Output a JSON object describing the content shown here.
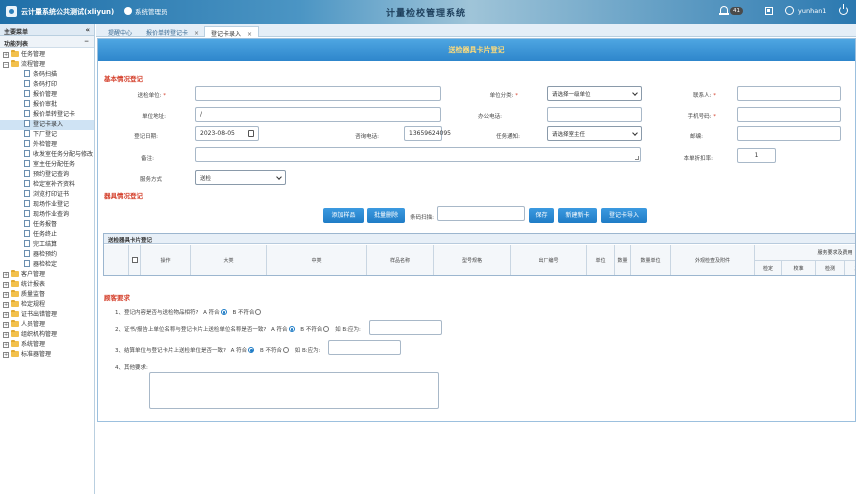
{
  "header": {
    "app_title": "云计量系统公共测试(xliyun)",
    "user_chip": "系统管理员",
    "system_title": "计量检校管理系统",
    "notification_count": "41",
    "username": "yunhan1"
  },
  "sidebar": {
    "main_menu": "主要菜单",
    "collapse": "«",
    "function_list": "功能列表",
    "function_toggle": "−",
    "items": [
      {
        "label": "任务管理",
        "type": "folder",
        "exp": "+"
      },
      {
        "label": "流程管理",
        "type": "folder",
        "exp": "−"
      },
      {
        "label": "条码扫描",
        "type": "leaf"
      },
      {
        "label": "条码打印",
        "type": "leaf"
      },
      {
        "label": "报价管理",
        "type": "leaf"
      },
      {
        "label": "报价审批",
        "type": "leaf"
      },
      {
        "label": "报价单转登记卡",
        "type": "leaf"
      },
      {
        "label": "登记卡录入",
        "type": "leaf",
        "active": true
      },
      {
        "label": "下厂登记",
        "type": "leaf"
      },
      {
        "label": "外检管理",
        "type": "leaf"
      },
      {
        "label": "收发室任务分配与修改",
        "type": "leaf"
      },
      {
        "label": "室主任分配任务",
        "type": "leaf"
      },
      {
        "label": "预约登记查询",
        "type": "leaf"
      },
      {
        "label": "检定室补齐资料",
        "type": "leaf"
      },
      {
        "label": "浏览打印证书",
        "type": "leaf"
      },
      {
        "label": "现场作业登记",
        "type": "leaf"
      },
      {
        "label": "现场作业查询",
        "type": "leaf"
      },
      {
        "label": "任务报督",
        "type": "leaf"
      },
      {
        "label": "任务终止",
        "type": "leaf"
      },
      {
        "label": "完工结算",
        "type": "leaf"
      },
      {
        "label": "器检预约",
        "type": "leaf"
      },
      {
        "label": "器检检定",
        "type": "leaf"
      },
      {
        "label": "客户管理",
        "type": "folder",
        "exp": "+"
      },
      {
        "label": "统计报表",
        "type": "folder",
        "exp": "+"
      },
      {
        "label": "质量监督",
        "type": "folder",
        "exp": "+"
      },
      {
        "label": "检定规程",
        "type": "folder",
        "exp": "+"
      },
      {
        "label": "证书出错管理",
        "type": "folder",
        "exp": "+"
      },
      {
        "label": "人员管理",
        "type": "folder",
        "exp": "+"
      },
      {
        "label": "组织机构管理",
        "type": "folder",
        "exp": "+"
      },
      {
        "label": "系统管理",
        "type": "folder",
        "exp": "+"
      },
      {
        "label": "标准器管理",
        "type": "folder",
        "exp": "+"
      }
    ]
  },
  "tabs": [
    {
      "label": "提醒中心",
      "active": false,
      "closable": false
    },
    {
      "label": "报价单转登记卡",
      "active": false,
      "closable": true
    },
    {
      "label": "登记卡录入",
      "active": true,
      "closable": true
    }
  ],
  "tab_close_glyph": "×",
  "form": {
    "banner": "送检器具卡片登记",
    "basic_section": "基本情况登记",
    "labels": {
      "submit_unit": "送检单位:",
      "unit_category": "单位分类:",
      "contact": "联系人:",
      "unit_address": "单位地址:",
      "office_phone": "办公电话:",
      "mobile": "手机号码:",
      "register_date": "登记日期:",
      "consult_phone": "咨询电话:",
      "task_notify": "任务通知:",
      "postcode": "邮编:",
      "remark": "备注:",
      "discount": "本单折扣率:",
      "service_mode": "服务方式"
    },
    "required_mark": "*",
    "values": {
      "submit_unit": "",
      "unit_address": "/",
      "office_phone": "",
      "mobile": "",
      "register_date": "2023-08-05",
      "consult_phone": "13659624095",
      "postcode": "",
      "remark": "",
      "discount": "1",
      "contact": ""
    },
    "selects": {
      "unit_category": "请选择一级单位",
      "task_notify": "请选择室主任",
      "service_mode": "送检"
    },
    "equipment_section": "器具情况登记",
    "buttons": {
      "add_sample": "添加样品",
      "batch_delete": "批量删除",
      "save": "保存",
      "new_card": "新建新卡",
      "import_card": "登记卡导入"
    },
    "barcode_label": "条码扫描:",
    "barcode_value": ""
  },
  "table": {
    "title": "送检器具卡片登记",
    "columns": [
      "",
      "操作",
      "大类",
      "中类",
      "样品名称",
      "型号规格",
      "出厂编号",
      "单位",
      "数量",
      "数量单位",
      "外观检查及附件"
    ],
    "group_header": "服务要求及费用",
    "sub_columns": [
      "检定",
      "校准",
      "检测",
      "其"
    ]
  },
  "customer": {
    "section": "顾客要求",
    "q1": "1、登记内容是否与送检物品相符?",
    "q2": "2、证书/报告上单位名称与登记卡片上送检单位名称是否一致?",
    "q3": "3、结算单位与登记卡片上送检单位是否一致?",
    "q4": "4、其他要求:",
    "opt_yes": "A 符合",
    "opt_no": "B 不符合",
    "opt_if_b": "如 B:应为:",
    "q2_value": "",
    "q3_value": "",
    "other_value": ""
  }
}
